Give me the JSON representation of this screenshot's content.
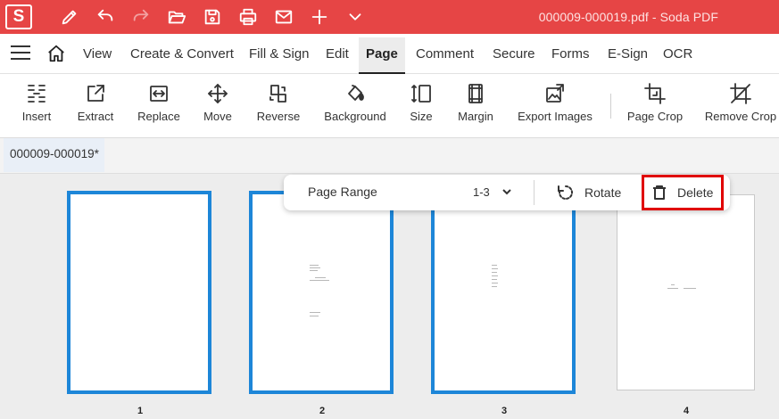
{
  "app": {
    "logo_letter": "S",
    "window_title": "000009-000019.pdf  -  Soda PDF",
    "brand_color": "#e64545"
  },
  "quick_actions": [
    "pen-icon",
    "undo-icon",
    "redo-icon",
    "open-folder-icon",
    "save-icon",
    "print-icon",
    "mail-icon",
    "plus-icon",
    "chevron-down-icon"
  ],
  "menu": {
    "items": [
      "View",
      "Create & Convert",
      "Fill & Sign",
      "Edit",
      "Page",
      "Comment",
      "Secure",
      "Forms",
      "E-Sign",
      "OCR"
    ],
    "active": "Page"
  },
  "toolbar": {
    "tools": [
      {
        "label": "Insert",
        "icon": "insert-icon"
      },
      {
        "label": "Extract",
        "icon": "extract-icon"
      },
      {
        "label": "Replace",
        "icon": "replace-icon"
      },
      {
        "label": "Move",
        "icon": "move-icon"
      },
      {
        "label": "Reverse",
        "icon": "reverse-icon"
      },
      {
        "label": "Background",
        "icon": "background-icon"
      },
      {
        "label": "Size",
        "icon": "size-icon"
      },
      {
        "label": "Margin",
        "icon": "margin-icon"
      },
      {
        "label": "Export Images",
        "icon": "export-images-icon"
      },
      {
        "label": "Page Crop",
        "icon": "page-crop-icon"
      },
      {
        "label": "Remove Crop",
        "icon": "remove-crop-icon"
      }
    ]
  },
  "document_tab": {
    "label": "000009-000019*"
  },
  "page_bar": {
    "range_label": "Page Range",
    "range_value": "1-3",
    "rotate_label": "Rotate",
    "delete_label": "Delete",
    "highlight_color": "#e00000"
  },
  "pages": [
    {
      "number": "1",
      "selected": true
    },
    {
      "number": "2",
      "selected": true
    },
    {
      "number": "3",
      "selected": true
    },
    {
      "number": "4",
      "selected": false
    }
  ],
  "selection_color": "#1d86d8"
}
